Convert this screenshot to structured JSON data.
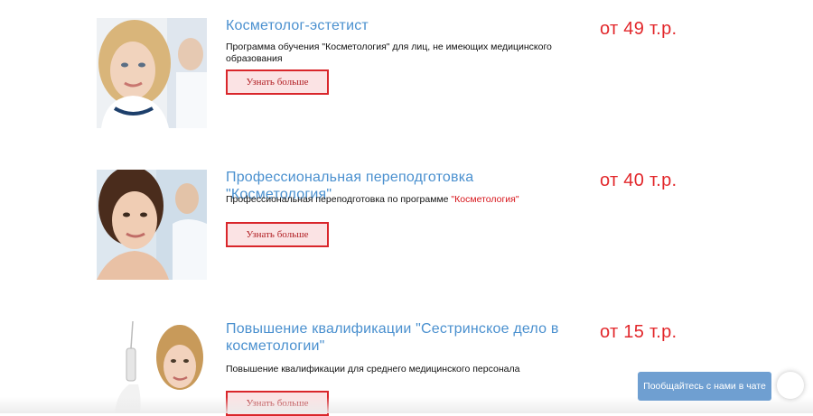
{
  "courses": [
    {
      "title": "Косметолог-эстетист",
      "description": "Программа обучения \"Косметология\" для лиц, не имеющих медицинского образования",
      "description_highlight": "",
      "price": "от 49 т.р.",
      "button_label": "Узнать больше"
    },
    {
      "title": "Профессиональная переподготовка \"Косметология\"",
      "description": "Профессиональная переподготовка по программе ",
      "description_highlight": "\"Косметология\"",
      "price": "от 40 т.р.",
      "button_label": "Узнать больше"
    },
    {
      "title": "Повышение квалификации \"Сестринское дело в косметологии\"",
      "description": "Повышение квалификации для среднего медицинского персонала",
      "description_highlight": "",
      "price": "от 15 т.р.",
      "button_label": "Узнать больше"
    }
  ],
  "chat": {
    "label": "Пообщайтесь с нами в чате"
  }
}
